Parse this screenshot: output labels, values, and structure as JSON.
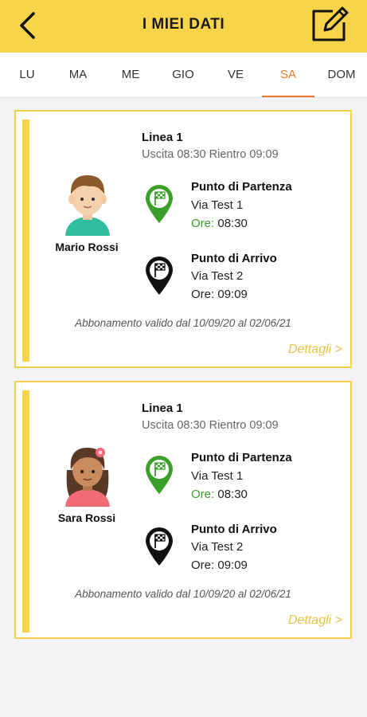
{
  "header": {
    "title": "I MIEI DATI",
    "back_icon": "chevron-left-icon",
    "edit_icon": "edit-note-icon"
  },
  "colors": {
    "header_bg": "#f7d44a",
    "accent": "#e8772e",
    "green": "#3aa02a",
    "card_border": "#f2cf4a",
    "details": "#eac24a"
  },
  "days": [
    {
      "label": "LU"
    },
    {
      "label": "MA"
    },
    {
      "label": "ME"
    },
    {
      "label": "GIO"
    },
    {
      "label": "VE"
    },
    {
      "label": "SA",
      "active": true
    },
    {
      "label": "DOM"
    }
  ],
  "cards": [
    {
      "name": "Mario Rossi",
      "avatar": "boy-avatar",
      "line": "Linea 1",
      "times": "Uscita 08:30  Rientro 09:09",
      "departure": {
        "title": "Punto di Partenza",
        "address": "Via Test 1",
        "time_label": "Ore:",
        "time": "08:30"
      },
      "arrival": {
        "title": "Punto di Arrivo",
        "address": "Via Test 2",
        "time_label": "Ore:",
        "time": "09:09"
      },
      "validity": "Abbonamento valido dal 10/09/20 al 02/06/21",
      "details": "Dettagli >"
    },
    {
      "name": "Sara Rossi",
      "avatar": "girl-avatar",
      "line": "Linea 1",
      "times": "Uscita 08:30  Rientro 09:09",
      "departure": {
        "title": "Punto di Partenza",
        "address": "Via Test 1",
        "time_label": "Ore:",
        "time": "08:30"
      },
      "arrival": {
        "title": "Punto di Arrivo",
        "address": "Via Test 2",
        "time_label": "Ore:",
        "time": "09:09"
      },
      "validity": "Abbonamento valido dal 10/09/20 al 02/06/21",
      "details": "Dettagli >"
    }
  ]
}
